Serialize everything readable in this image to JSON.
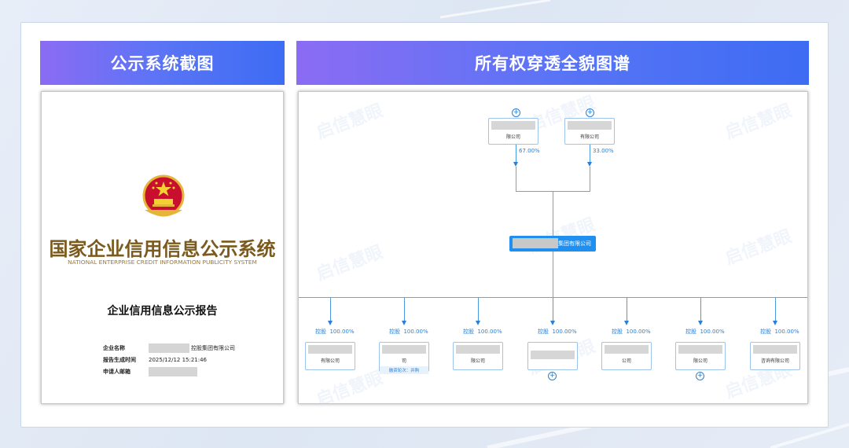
{
  "headers": {
    "left": "公示系统截图",
    "right": "所有权穿透全貌图谱"
  },
  "document": {
    "system_title": "国家企业信用信息公示系统",
    "system_subtitle": "NATIONAL ENTERPRISE CREDIT INFORMATION PUBLICITY SYSTEM",
    "report_title": "企业信用信息公示报告",
    "fields": [
      {
        "key": "企业名称",
        "value": "控股集团有限公司"
      },
      {
        "key": "报告生成时间",
        "value": "2025/12/12 15:21:46"
      },
      {
        "key": "申请人邮箱",
        "value": ""
      }
    ]
  },
  "graph": {
    "watermark": "启信慧眼",
    "shareholders": [
      {
        "name": "限公司",
        "percent": "67.00%"
      },
      {
        "name": "有限公司",
        "percent": "33.00%"
      }
    ],
    "center_name": "集团有限公司",
    "subsidiaries": [
      {
        "tag": "控股",
        "percent": "100.00%",
        "name": "有限公司",
        "note": ""
      },
      {
        "tag": "控股",
        "percent": "100.00%",
        "name": "司",
        "note": "融资轮次：并购"
      },
      {
        "tag": "控股",
        "percent": "100.00%",
        "name": "限公司",
        "note": ""
      },
      {
        "tag": "控股",
        "percent": "100.00%",
        "name": "",
        "note": ""
      },
      {
        "tag": "控股",
        "percent": "100.00%",
        "name": "公司",
        "note": ""
      },
      {
        "tag": "控股",
        "percent": "100.00%",
        "name": "限公司",
        "note": ""
      },
      {
        "tag": "控股",
        "percent": "100.00%",
        "name": "咨询有限公司",
        "note": ""
      }
    ],
    "expand_symbol": "+"
  },
  "colors": {
    "header_gradient_start": "#8b6cf4",
    "header_gradient_end": "#3d6cf3",
    "accent_blue": "#2a80d6",
    "center_node": "#1f8ff0",
    "title_gold": "#7a5a1e"
  }
}
